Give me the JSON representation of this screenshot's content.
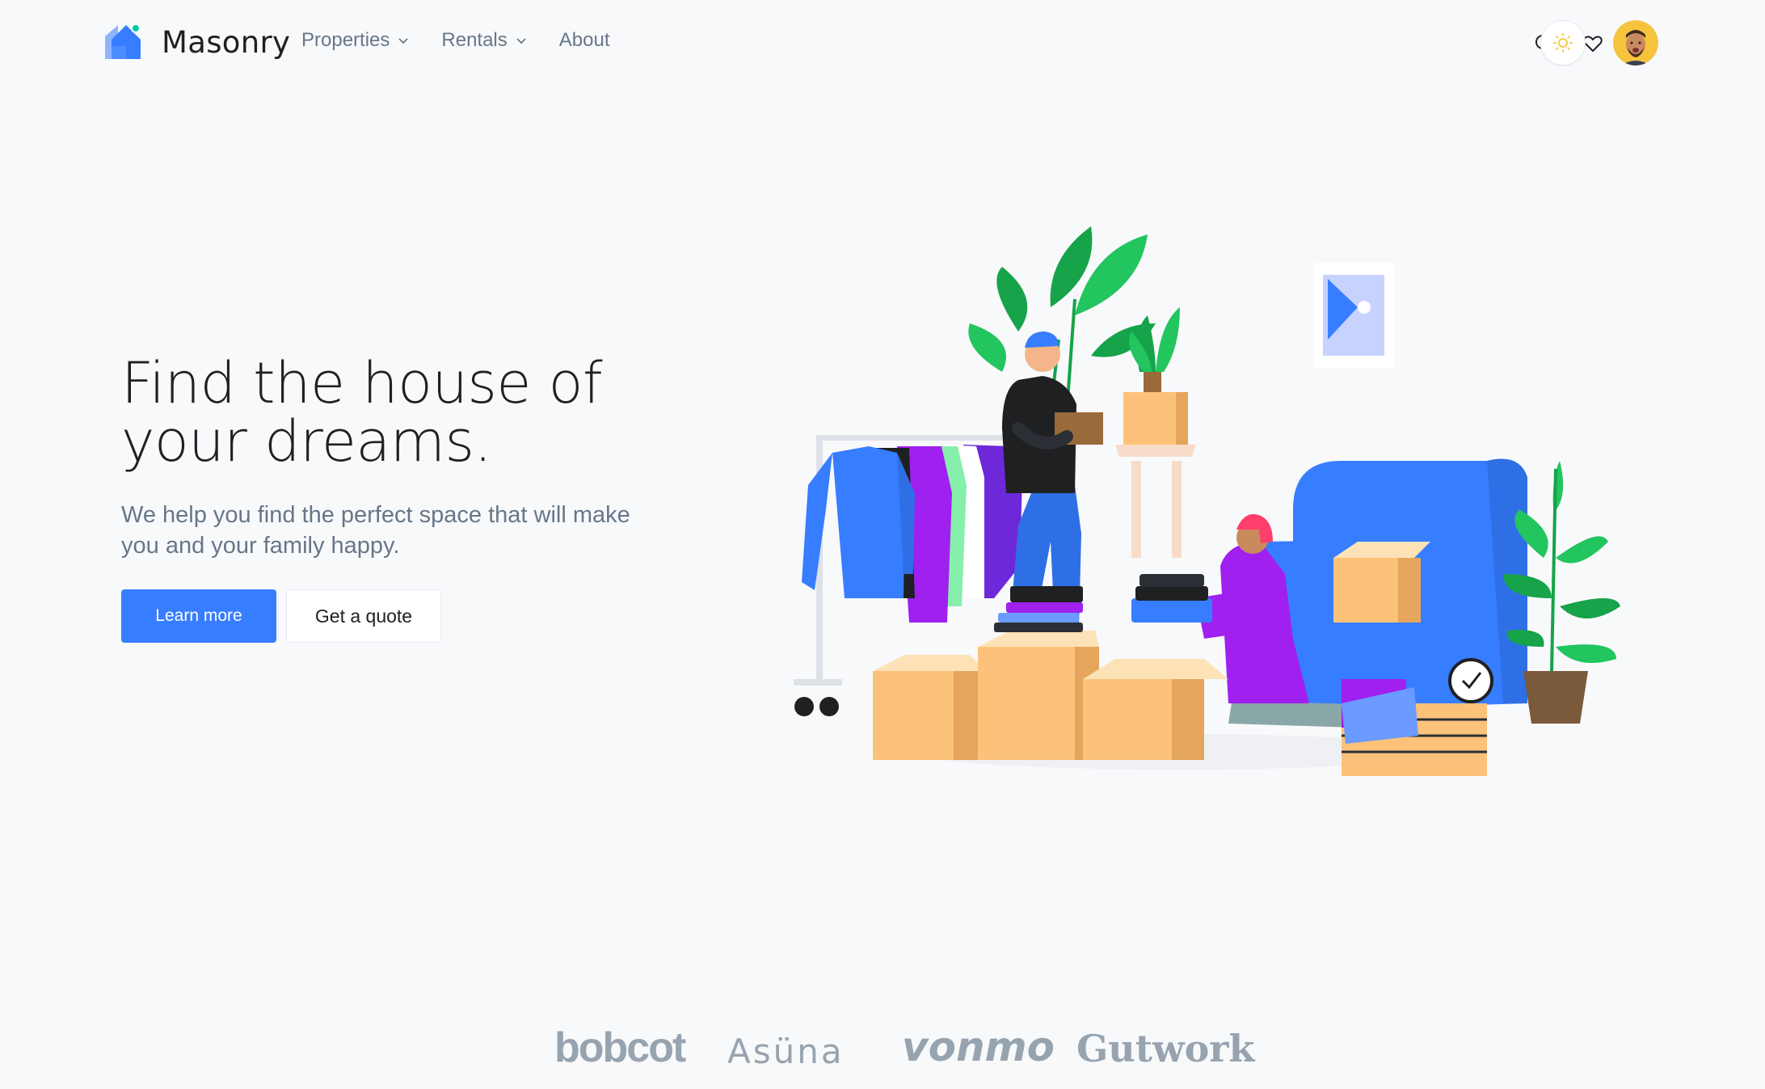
{
  "app": {
    "logo_text": "Masonry"
  },
  "nav": {
    "items": [
      {
        "label": "Properties",
        "has_dropdown": true
      },
      {
        "label": "Rentals",
        "has_dropdown": true
      },
      {
        "label": "About",
        "has_dropdown": false
      }
    ]
  },
  "header_actions": {
    "icons": [
      "search-icon",
      "heart-icon",
      "sun-icon",
      "user-avatar"
    ]
  },
  "hero": {
    "title": "Find the house of your dreams.",
    "subtitle": "We help you find the perfect space that will make you and your family happy.",
    "primary_button": "Learn more",
    "secondary_button": "Get a quote"
  },
  "partners": [
    "bobcot",
    "Asüna",
    "vonmo",
    "Gutwork"
  ],
  "colors": {
    "accent": "#377dff",
    "text_dark": "#1e2022",
    "text_muted": "#677788",
    "background": "#f8f9fb",
    "partner_logo": "#97a4af",
    "sun": "#f5ca4e"
  }
}
